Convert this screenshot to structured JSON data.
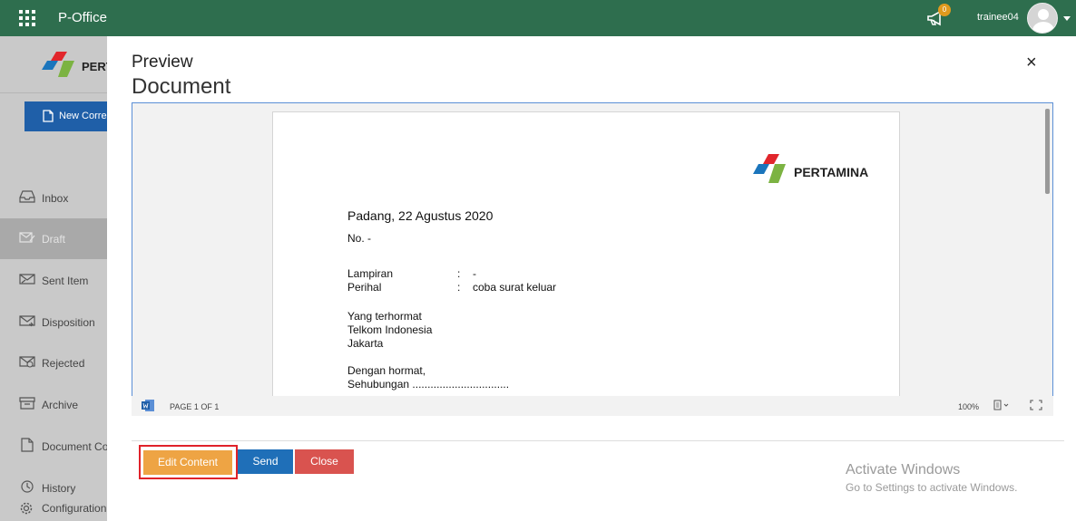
{
  "topbar": {
    "app_title": "P-Office",
    "notification_count": "0",
    "username": "trainee04"
  },
  "sidebar": {
    "logo_text": "PERTAMINA",
    "new_button_label": "New Correspondence",
    "items": [
      {
        "label": "Inbox",
        "icon": "inbox-icon"
      },
      {
        "label": "Draft",
        "icon": "draft-icon"
      },
      {
        "label": "Sent Item",
        "icon": "sent-icon"
      },
      {
        "label": "Disposition",
        "icon": "disposition-icon"
      },
      {
        "label": "Rejected",
        "icon": "rejected-icon"
      },
      {
        "label": "Archive",
        "icon": "archive-icon"
      },
      {
        "label": "Document Control",
        "icon": "document-control-icon"
      },
      {
        "label": "History",
        "icon": "history-icon"
      },
      {
        "label": "Configuration",
        "icon": "gear-icon"
      }
    ],
    "active_item": "Draft"
  },
  "modal": {
    "title": "Preview",
    "subtitle": "Document",
    "close_glyph": "×"
  },
  "document": {
    "logo_text": "PERTAMINA",
    "place_date": "Padang, 22 Agustus 2020",
    "number": "No. -",
    "lampiran_label": "Lampiran",
    "lampiran_sep": ":",
    "lampiran_value": "-",
    "perihal_label": "Perihal",
    "perihal_sep": ":",
    "perihal_value": "coba surat keluar",
    "recipient_greeting": "Yang terhormat",
    "recipient_name": "Telkom Indonesia",
    "recipient_city": "Jakarta",
    "salutation": "Dengan hormat,",
    "body_start": "Sehubungan ................................"
  },
  "viewer_status": {
    "page_info": "PAGE 1 OF 1",
    "zoom": "100%"
  },
  "actions": {
    "edit_label": "Edit Content",
    "send_label": "Send",
    "close_label": "Close"
  },
  "watermark": {
    "line1": "Activate Windows",
    "line2": "Go to Settings to activate Windows."
  },
  "colors": {
    "topbar": "#2e6e4e",
    "primary": "#1f6fb8",
    "warning": "#eea444",
    "danger": "#d9534f",
    "highlight_frame": "#e0222a"
  }
}
